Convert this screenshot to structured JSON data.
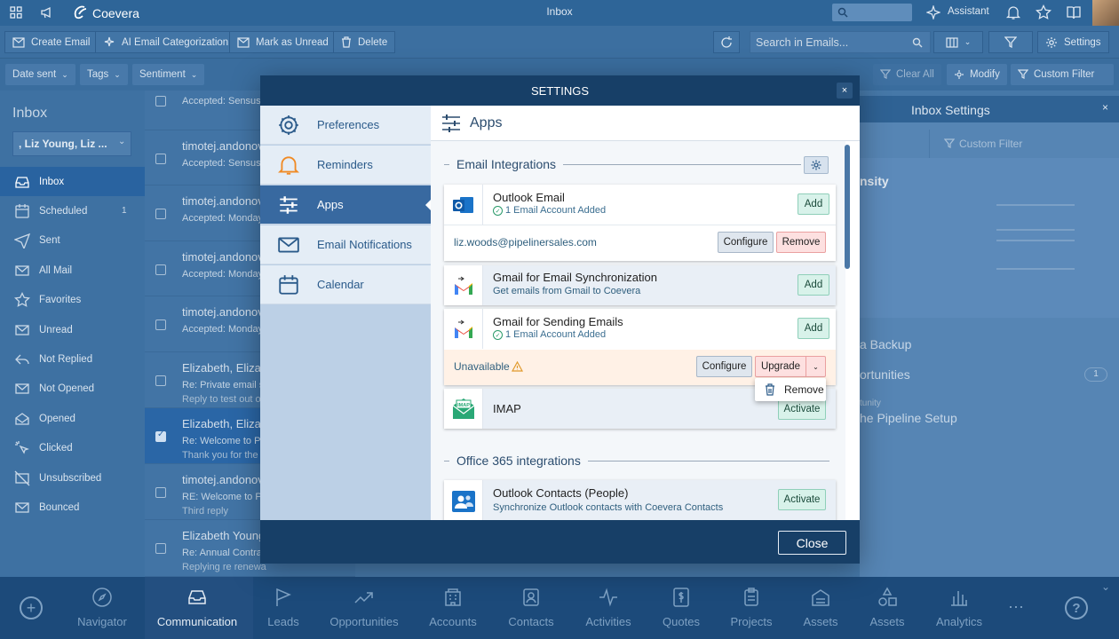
{
  "app": {
    "name": "Coevera",
    "window_title": "Inbox",
    "assistant_label": "Assistant"
  },
  "toolbar": {
    "create_email": "Create Email",
    "ai_categorization": "AI Email Categorization",
    "mark_unread": "Mark as Unread",
    "delete": "Delete",
    "search_placeholder": "Search in Emails...",
    "settings": "Settings"
  },
  "filters": {
    "date_sent": "Date sent",
    "tags": "Tags",
    "sentiment": "Sentiment",
    "clear_all": "Clear All",
    "modify": "Modify",
    "custom_filter": "Custom Filter"
  },
  "sidebar": {
    "title": "Inbox",
    "account": ", Liz Young, Liz ...",
    "items": [
      {
        "label": "Inbox",
        "icon": "inbox-icon"
      },
      {
        "label": "Scheduled",
        "icon": "calendar-clock-icon",
        "count": "1"
      },
      {
        "label": "Sent",
        "icon": "send-icon"
      },
      {
        "label": "All Mail",
        "icon": "mail-icon"
      },
      {
        "label": "Favorites",
        "icon": "star-icon"
      },
      {
        "label": "Unread",
        "icon": "mail-unread-icon"
      },
      {
        "label": "Not Replied",
        "icon": "reply-icon"
      },
      {
        "label": "Not Opened",
        "icon": "mail-closed-icon"
      },
      {
        "label": "Opened",
        "icon": "mail-open-icon"
      },
      {
        "label": "Clicked",
        "icon": "click-icon"
      },
      {
        "label": "Unsubscribed",
        "icon": "unsubscribe-icon"
      },
      {
        "label": "Bounced",
        "icon": "bounce-icon"
      }
    ]
  },
  "messages": [
    {
      "name": "",
      "subject": "Accepted: Sensus",
      "preview": ""
    },
    {
      "name": "timotej.andonov",
      "subject": "Accepted: Sensus",
      "preview": ""
    },
    {
      "name": "timotej.andonov",
      "subject": "Accepted: Monday",
      "preview": ""
    },
    {
      "name": "timotej.andonov",
      "subject": "Accepted: Monday",
      "preview": ""
    },
    {
      "name": "timotej.andonov",
      "subject": "Accepted: Monday",
      "preview": ""
    },
    {
      "name": "Elizabeth, Elizab",
      "subject": "Re: Private email s",
      "preview": "Reply to test out o"
    },
    {
      "name": "Elizabeth, Elizab",
      "subject": "Re: Welcome to Pi",
      "preview": "Thank you for the"
    },
    {
      "name": "timotej.andonov",
      "subject": "RE: Welcome to Pi",
      "preview": "Third reply"
    },
    {
      "name": "Elizabeth Young",
      "subject": "Re: Annual Contra",
      "preview": "Replying re renewa"
    }
  ],
  "inbox_settings": {
    "title": "Inbox Settings",
    "custom_filter": "Custom Filter",
    "density": "nsity",
    "backup": "a Backup",
    "opportunities": "ortunities",
    "opp_count": "1",
    "tunity": "tunity",
    "pipeline": "he Pipeline Setup"
  },
  "bottom_nav": [
    {
      "label": "Navigator",
      "icon": "compass-icon"
    },
    {
      "label": "Communication",
      "icon": "inbox-tray-icon"
    },
    {
      "label": "Leads",
      "icon": "flag-icon"
    },
    {
      "label": "Opportunities",
      "icon": "trend-icon"
    },
    {
      "label": "Accounts",
      "icon": "building-icon"
    },
    {
      "label": "Contacts",
      "icon": "contact-card-icon"
    },
    {
      "label": "Activities",
      "icon": "pulse-icon"
    },
    {
      "label": "Quotes",
      "icon": "dollar-doc-icon"
    },
    {
      "label": "Projects",
      "icon": "clipboard-icon"
    },
    {
      "label": "Assets",
      "icon": "stack-icon"
    },
    {
      "label": "Assets",
      "icon": "shapes-icon"
    },
    {
      "label": "Analytics",
      "icon": "bar-chart-icon"
    }
  ],
  "modal": {
    "title": "SETTINGS",
    "close_label": "Close",
    "nav": [
      {
        "label": "Preferences",
        "icon": "gear-icon"
      },
      {
        "label": "Reminders",
        "icon": "bell-icon"
      },
      {
        "label": "Apps",
        "icon": "sliders-icon"
      },
      {
        "label": "Email Notifications",
        "icon": "envelope-icon"
      },
      {
        "label": "Calendar",
        "icon": "calendar-icon"
      }
    ],
    "page_title": "Apps",
    "email_section": "Email Integrations",
    "office_section": "Office 365 integrations",
    "outlook": {
      "title": "Outlook Email",
      "status": "1 Email Account Added",
      "add": "Add",
      "account": "liz.woods@pipelinersales.com",
      "configure": "Configure",
      "remove": "Remove"
    },
    "gmail_sync": {
      "title": "Gmail for Email Synchronization",
      "desc": "Get emails from Gmail to Coevera",
      "add": "Add"
    },
    "gmail_send": {
      "title": "Gmail for Sending Emails",
      "status": "1 Email Account Added",
      "add": "Add",
      "unavailable": "Unavailable",
      "configure": "Configure",
      "upgrade": "Upgrade",
      "remove": "Remove"
    },
    "imap": {
      "title": "IMAP",
      "activate": "Activate"
    },
    "contacts": {
      "title": "Outlook Contacts (People)",
      "desc": "Synchronize Outlook contacts with Coevera Contacts",
      "activate": "Activate"
    }
  },
  "colors": {
    "accent": "#173f67",
    "success": "#d8f2ea",
    "danger": "#fde0e0",
    "warning": "#fff1e6"
  }
}
